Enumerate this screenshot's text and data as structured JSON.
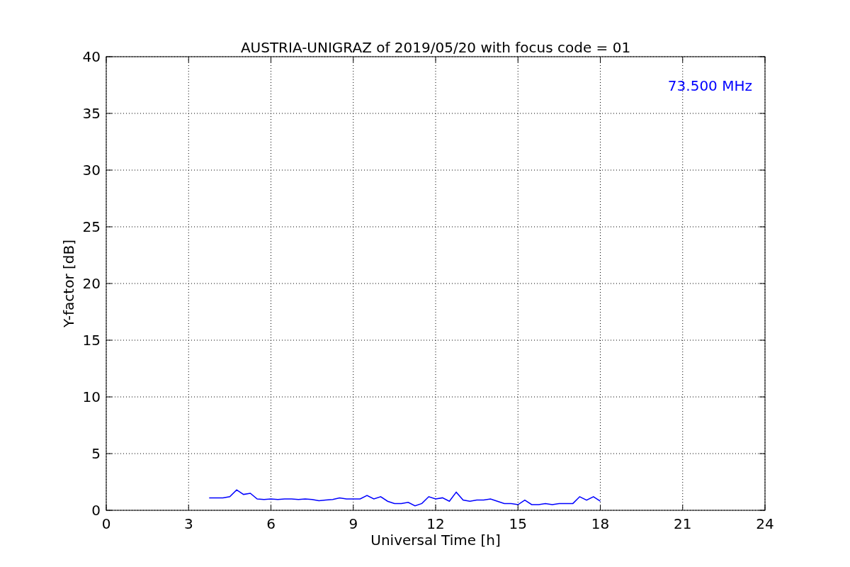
{
  "chart_data": {
    "type": "line",
    "title": "AUSTRIA-UNIGRAZ of 2019/05/20 with focus code = 01",
    "xlabel": "Universal Time [h]",
    "ylabel": "Y-factor [dB]",
    "x": [
      3.75,
      4.0,
      4.25,
      4.5,
      4.75,
      5.0,
      5.25,
      5.5,
      5.75,
      6.0,
      6.25,
      6.5,
      6.75,
      7.0,
      7.25,
      7.5,
      7.75,
      8.0,
      8.25,
      8.5,
      8.75,
      9.0,
      9.25,
      9.5,
      9.75,
      10.0,
      10.25,
      10.5,
      10.75,
      11.0,
      11.25,
      11.5,
      11.75,
      12.0,
      12.25,
      12.5,
      12.75,
      13.0,
      13.25,
      13.5,
      13.75,
      14.0,
      14.25,
      14.5,
      14.75,
      15.0,
      15.25,
      15.5,
      15.75,
      16.0,
      16.25,
      16.5,
      16.75,
      17.0,
      17.25,
      17.5,
      17.75,
      18.0
    ],
    "series": [
      {
        "color": "#0000ff",
        "values": [
          1.1,
          1.1,
          1.1,
          1.2,
          1.8,
          1.4,
          1.5,
          1.0,
          0.95,
          1.0,
          0.95,
          1.0,
          1.0,
          0.95,
          1.0,
          0.95,
          0.85,
          0.9,
          0.95,
          1.1,
          1.0,
          1.0,
          1.0,
          1.3,
          1.0,
          1.2,
          0.8,
          0.6,
          0.6,
          0.7,
          0.4,
          0.6,
          1.2,
          1.0,
          1.1,
          0.8,
          1.6,
          0.9,
          0.8,
          0.9,
          0.9,
          1.0,
          0.8,
          0.6,
          0.6,
          0.5,
          0.9,
          0.5,
          0.5,
          0.6,
          0.5,
          0.6,
          0.6,
          0.6,
          1.2,
          0.9,
          1.2,
          0.8
        ]
      }
    ],
    "xlim": [
      0,
      24
    ],
    "ylim": [
      0,
      40
    ],
    "xticks": [
      0,
      3,
      6,
      9,
      12,
      15,
      18,
      21,
      24
    ],
    "yticks": [
      0,
      5,
      10,
      15,
      20,
      25,
      30,
      35,
      40
    ],
    "grid": true,
    "annotations": [
      {
        "text": "73.500 MHz"
      }
    ]
  }
}
